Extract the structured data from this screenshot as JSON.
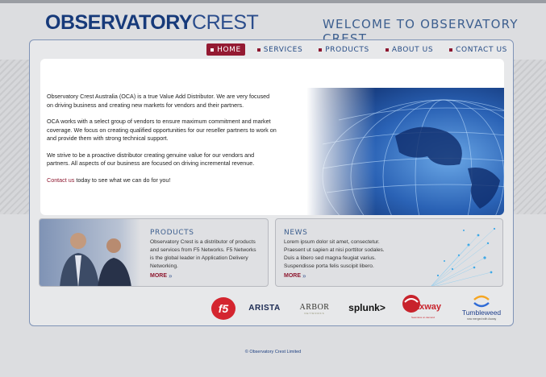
{
  "brand": {
    "logo_part1": "OBSERVATORY",
    "logo_part2": "CREST",
    "welcome": "WELCOME TO OBSERVATORY CREST"
  },
  "nav": {
    "items": [
      {
        "label": "HOME",
        "active": true
      },
      {
        "label": "SERVICES",
        "active": false
      },
      {
        "label": "PRODUCTS",
        "active": false
      },
      {
        "label": "ABOUT US",
        "active": false
      },
      {
        "label": "CONTACT US",
        "active": false
      }
    ]
  },
  "intro": {
    "p1": "Observatory Crest Australia (OCA) is a true Value Add Distributor. We are very focused on driving business and creating new markets for vendors and their partners.",
    "p2": " OCA works with a select group of vendors to ensure maximum commitment and market coverage. We focus on creating qualified opportunities for our reseller partners to work on and provide them with strong technical support.",
    "p3": "We strive to be a proactive distributor creating genuine value for our vendors and partners. All aspects of our business are focused on driving incremental revenue.",
    "contact_link": "Contact us",
    "contact_rest": " today to see what we can do for you!"
  },
  "products": {
    "title": "PRODUCTS",
    "body": "Observatory Crest is a distributor of products and services from F5 Networks. F5 Networks is the global leader in Application Delivery Networking.",
    "more": "MORE"
  },
  "news": {
    "title": "NEWS",
    "body": "Lorem ipsum dolor sit amet, consectetur. Praesent ut sapien at nisi porttitor sodales. Duis a libero sed magna feugiat varius. Suspendisse porta felis suscipit libero.",
    "more": "MORE"
  },
  "partners": {
    "f5": "f5",
    "arista": "ARISTA",
    "arbor": "ARBOR",
    "arbor_sub": "NETWORKS",
    "splunk": "splunk>",
    "axway": "axway",
    "axway_sub": "Seamless on demand",
    "tumbleweed": "Tumbleweed",
    "tumbleweed_sub": "now merged with Axway"
  },
  "footer": {
    "text": "© Observatory Crest Limited"
  },
  "colors": {
    "accent": "#941a32",
    "brand_blue": "#173a7a",
    "frame_border": "#7f93b6"
  }
}
